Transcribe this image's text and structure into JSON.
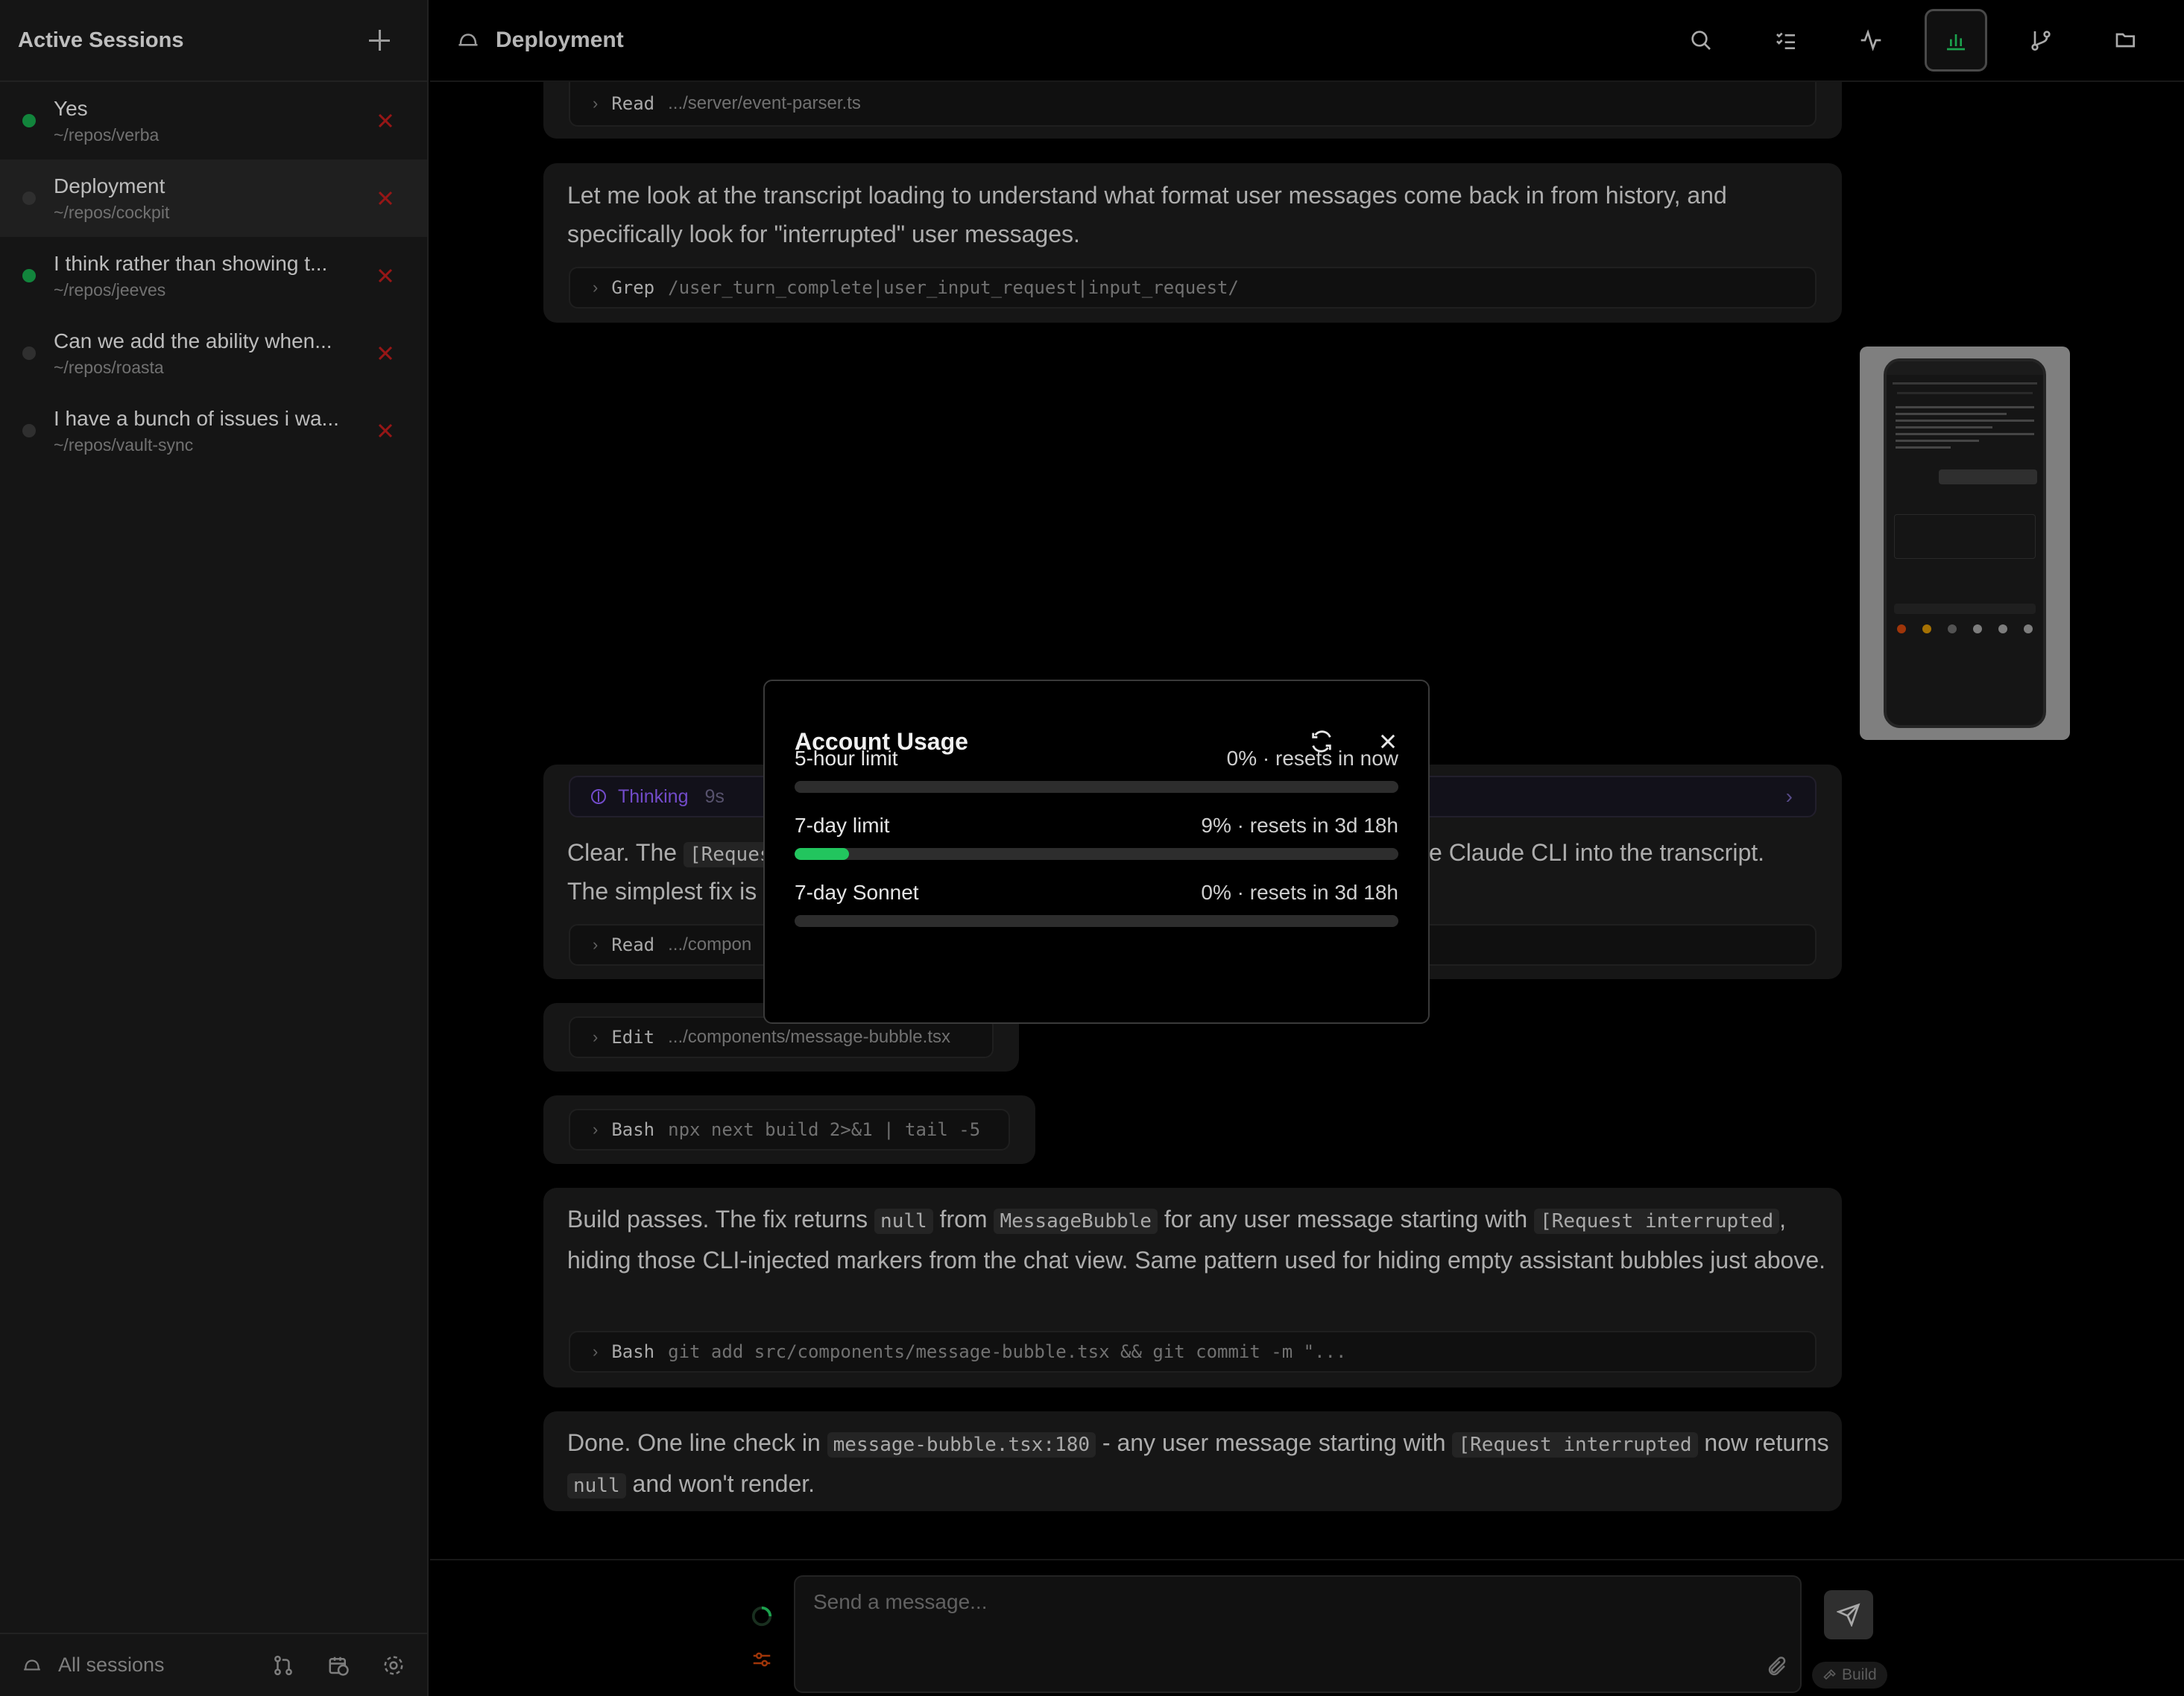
{
  "sidebar": {
    "title": "Active Sessions",
    "sessions": [
      {
        "title": "Yes",
        "path": "~/repos/verba",
        "status_color": "#16a34a"
      },
      {
        "title": "Deployment",
        "path": "~/repos/cockpit",
        "status_color": "#3a3a3a"
      },
      {
        "title": "I think rather than showing t...",
        "path": "~/repos/jeeves",
        "status_color": "#16a34a"
      },
      {
        "title": "Can we add the ability when...",
        "path": "~/repos/roasta",
        "status_color": "#3a3a3a"
      },
      {
        "title": "I have a bunch of issues i wa...",
        "path": "~/repos/vault-sync",
        "status_color": "#3a3a3a"
      }
    ],
    "footer_label": "All sessions"
  },
  "header": {
    "title": "Deployment"
  },
  "transcript": {
    "tool1": {
      "name": "Read",
      "arg": ".../server/event-parser.ts"
    },
    "msg1": "Let me look at the transcript loading to understand what format user messages come back in from history, and specifically look for \"interrupted\" user messages.",
    "tool2": {
      "name": "Grep",
      "arg": "/user_turn_complete|user_input_request|input_request/"
    },
    "thinking": {
      "label": "Thinking",
      "duration": "9s"
    },
    "msg2_line1_start": "Clear. The",
    "msg2_code": "[Reques",
    "msg2_line1_end": "e Claude CLI into the transcript.",
    "msg2_line2": "The simplest fix is",
    "tool3": {
      "name": "Read",
      "arg": ".../compon"
    },
    "tool4": {
      "name": "Edit",
      "arg": ".../components/message-bubble.tsx"
    },
    "tool5": {
      "name": "Bash",
      "arg": "npx next build 2>&1 | tail -5"
    },
    "msg3": {
      "t1": "Build passes. The fix returns",
      "c1": "null",
      "t2": "from",
      "c2": "MessageBubble",
      "t3": "for any user message starting with",
      "c3": "[Request interrupted",
      "t4": ",",
      "t5": "hiding those CLI-injected markers from the chat view. Same pattern used for hiding empty assistant bubbles just above."
    },
    "tool6": {
      "name": "Bash",
      "arg": "git add src/components/message-bubble.tsx && git commit -m \"..."
    },
    "msg4": {
      "t1": "Done. One line check in",
      "c1": "message-bubble.tsx:180",
      "t2": "- any user message starting with",
      "c2": "[Request interrupted",
      "t3": "now",
      "t4": "returns",
      "c3": "null",
      "t5": "and won't render."
    }
  },
  "input": {
    "placeholder": "Send a message...",
    "mode_badge": "Build"
  },
  "modal": {
    "title": "Account Usage",
    "items": [
      {
        "label": "5-hour limit",
        "value": "0% · resets in now",
        "fraction": 0.0
      },
      {
        "label": "7-day limit",
        "value": "9% · resets in 3d 18h",
        "fraction": 0.09
      },
      {
        "label": "7-day Sonnet",
        "value": "0% · resets in 3d 18h",
        "fraction": 0.0
      }
    ]
  },
  "colors": {
    "accent_green": "#22c55e",
    "close_red": "#b91c1c",
    "thinking_purple": "#8b5cf6"
  }
}
